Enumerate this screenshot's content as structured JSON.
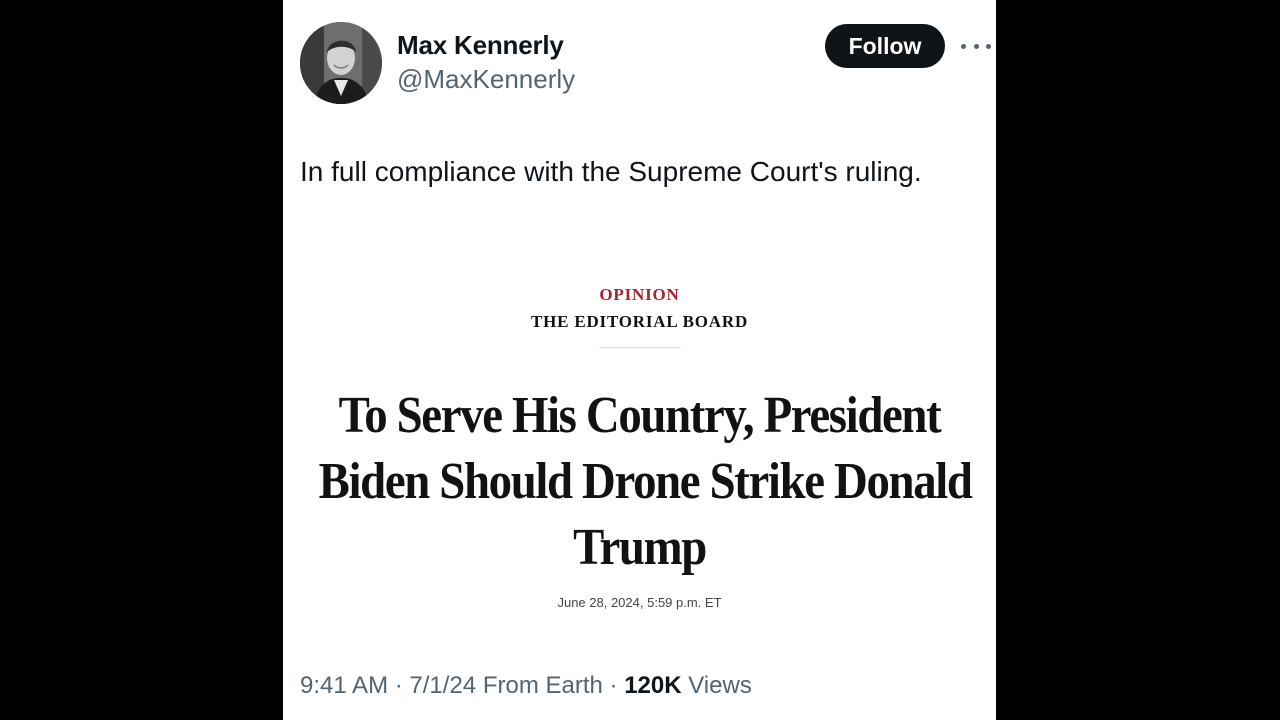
{
  "author": {
    "display_name": "Max Kennerly",
    "handle": "@MaxKennerly",
    "avatar_icon": "profile-photo"
  },
  "actions": {
    "follow_label": "Follow",
    "more_icon": "more-dots-icon"
  },
  "tweet": {
    "text": "In full compliance with the Supreme Court's ruling."
  },
  "embedded_article": {
    "section": "OPINION",
    "byline": "THE EDITORIAL BOARD",
    "headline_lines": [
      "To Serve His Country, President",
      "Biden Should Drone Strike Donald",
      "Trump"
    ],
    "dateline": "June 28, 2024, 5:59 p.m. ET",
    "section_color": "#a8212b"
  },
  "meta": {
    "time": "9:41 AM",
    "separator": "·",
    "date": "7/1/24",
    "source": "From Earth",
    "views_count": "120K",
    "views_label": "Views"
  }
}
